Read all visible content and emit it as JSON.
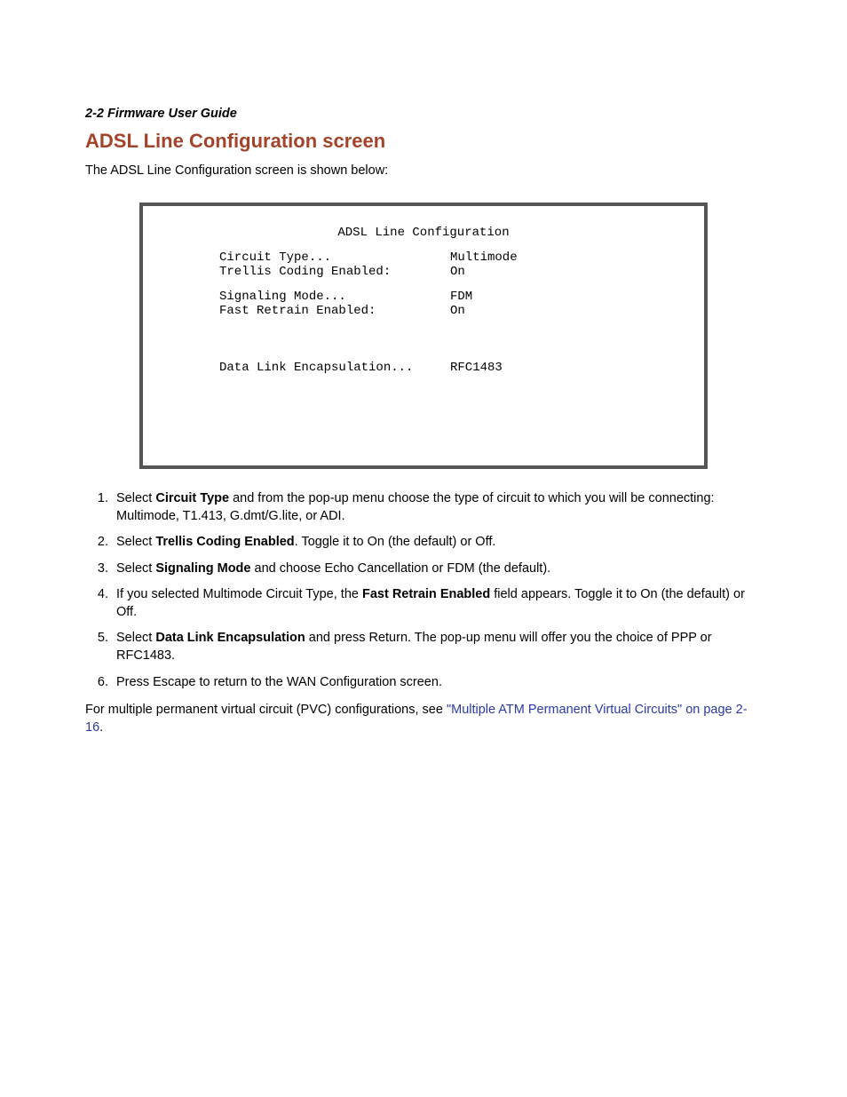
{
  "header": {
    "page_ref": "2-2  Firmware User Guide"
  },
  "heading": "ADSL Line Configuration screen",
  "intro": "The ADSL Line Configuration screen is shown below:",
  "terminal": {
    "title": "ADSL Line Configuration",
    "rows": {
      "circuit_type_label": "Circuit Type...",
      "circuit_type_value": "Multimode",
      "trellis_label": "Trellis Coding Enabled:",
      "trellis_value": "On",
      "signaling_label": "Signaling Mode...",
      "signaling_value": "FDM",
      "fast_retrain_label": "Fast Retrain Enabled:",
      "fast_retrain_value": "On",
      "encap_label": "Data Link Encapsulation...",
      "encap_value": "RFC1483"
    }
  },
  "steps": {
    "s1a": "Select ",
    "s1b": "Circuit Type",
    "s1c": " and from the pop-up menu choose the type of circuit to which you will be connecting: Multimode, T1.413, G.dmt/G.lite, or ADI.",
    "s2a": "Select ",
    "s2b": "Trellis Coding Enabled",
    "s2c": ". Toggle it to On (the default) or Off.",
    "s3a": "Select ",
    "s3b": "Signaling Mode",
    "s3c": " and choose Echo Cancellation or FDM (the default).",
    "s4a": "If you selected Multimode Circuit Type, the ",
    "s4b": "Fast Retrain Enabled",
    "s4c": " field appears. Toggle it to On (the default) or Off.",
    "s5a": "Select ",
    "s5b": "Data Link Encapsulation",
    "s5c": " and press Return. The pop-up menu will offer you the choice of PPP or RFC1483.",
    "s6": "Press Escape to return to the WAN Configuration screen."
  },
  "footer": {
    "text_before": "For multiple permanent virtual circuit (PVC) configurations, see ",
    "link_text": "\"Multiple ATM Permanent Virtual Circuits\" on page 2-16",
    "text_after": "."
  }
}
